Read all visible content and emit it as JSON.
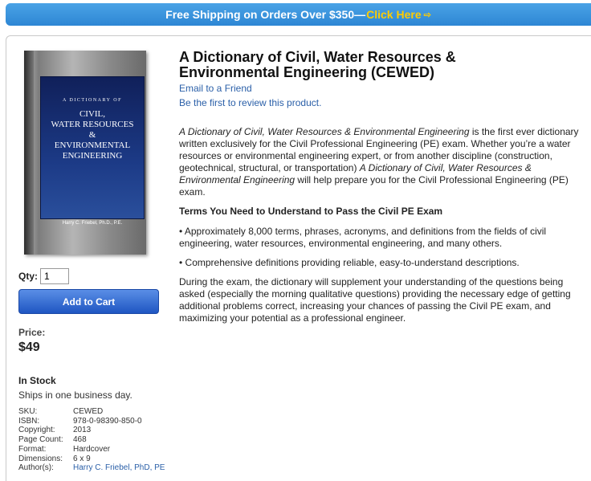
{
  "banner": {
    "text": "Free Shipping on Orders Over $350—",
    "link": "Click Here",
    "arrow_icon": "arrow-right-icon"
  },
  "cover": {
    "small_title": "A DICTIONARY OF",
    "line1": "CIVIL,",
    "line2": "WATER RESOURCES",
    "line3": "&",
    "line4": "ENVIRONMENTAL",
    "line5": "ENGINEERING",
    "author": "Harry C. Friebel, Ph.D., P.E."
  },
  "purchase": {
    "qty_label": "Qty:",
    "qty_value": "1",
    "add_to_cart": "Add to Cart",
    "price_label": "Price:",
    "price": "$49",
    "stock": "In Stock",
    "ships": "Ships in one business day."
  },
  "specs": [
    {
      "k": "SKU:",
      "v": "CEWED"
    },
    {
      "k": "ISBN:",
      "v": "978-0-98390-850-0"
    },
    {
      "k": "Copyright:",
      "v": "2013"
    },
    {
      "k": "Page Count:",
      "v": "468"
    },
    {
      "k": "Format:",
      "v": "Hardcover"
    },
    {
      "k": "Dimensions:",
      "v": "6 x 9"
    },
    {
      "k": "Author(s):",
      "v": "Harry C. Friebel, PhD, PE"
    }
  ],
  "product": {
    "title": "A Dictionary of Civil, Water Resources & Environmental Engineering (CEWED)",
    "email_link": "Email to a Friend",
    "review_link": "Be the first to review this product."
  },
  "description": {
    "p1_em": "A Dictionary of Civil, Water Resources & Environmental Engineering",
    "p1_a": " is the first ever dictionary written exclusively for the Civil Professional Engineering (PE) exam. Whether you’re a water resources or environmental engineering expert, or from another discipline (construction, geotechnical, structural, or transportation) ",
    "p1_em2": "A Dictionary of Civil, Water Resources & Environmental Engineering",
    "p1_b": " will help prepare you for the Civil Professional Engineering (PE) exam.",
    "heading": "Terms You Need to Understand to Pass the Civil PE Exam",
    "bullet1": "• Approximately 8,000 terms, phrases, acronyms, and definitions from the fields of civil engineering, water resources, environmental engineering, and many others.",
    "bullet2": "• Comprehensive definitions providing reliable, easy-to-understand descriptions.",
    "p2": "During the exam, the dictionary will supplement your understanding of the questions being asked (especially the morning qualitative questions) providing the necessary edge of getting additional problems correct, increasing your chances of passing the Civil PE exam, and maximizing your potential as a professional engineer."
  }
}
